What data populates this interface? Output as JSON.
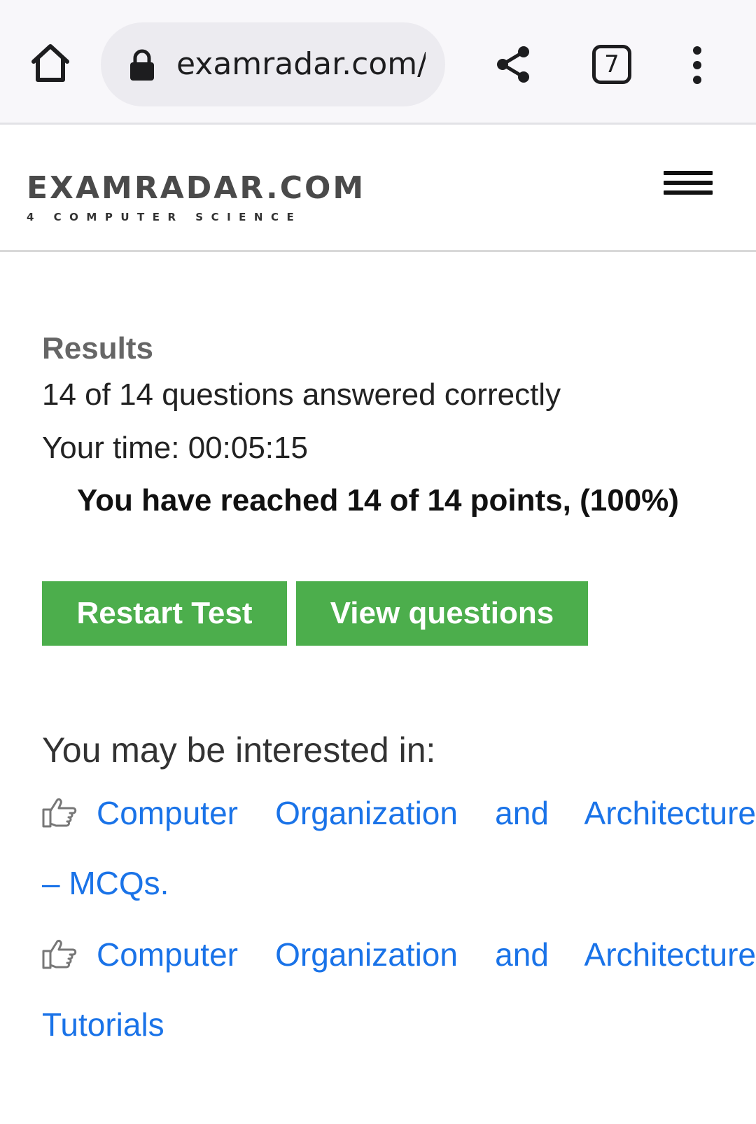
{
  "browser": {
    "url": "examradar.com/c",
    "tab_count": "7",
    "icons": {
      "home": "home-icon",
      "lock": "lock-icon",
      "share": "share-icon",
      "tabs": "tabs-icon",
      "menu": "more-vert-icon"
    }
  },
  "site": {
    "logo_title": "EXAMRADAR.COM",
    "logo_tagline": "4 COMPUTER SCIENCE",
    "menu_icon": "hamburger-icon"
  },
  "results": {
    "heading": "Results",
    "summary": "14 of 14 questions answered correctly",
    "time": "Your time: 00:05:15",
    "points": "You have reached 14 of 14 points, (100%)",
    "correct": 14,
    "total": 14,
    "percent": 100
  },
  "buttons": {
    "restart": "Restart Test",
    "view": "View questions",
    "color": "#4cae4c"
  },
  "related": {
    "heading": "You may be interested in:",
    "icon": "pointing-hand-icon",
    "link_color": "#1a73e8",
    "items": [
      {
        "line1": "Computer Organization and Architecture",
        "line2": "– MCQs."
      },
      {
        "line1": "Computer Organization and Architecture",
        "line2": "Tutorials"
      }
    ]
  }
}
